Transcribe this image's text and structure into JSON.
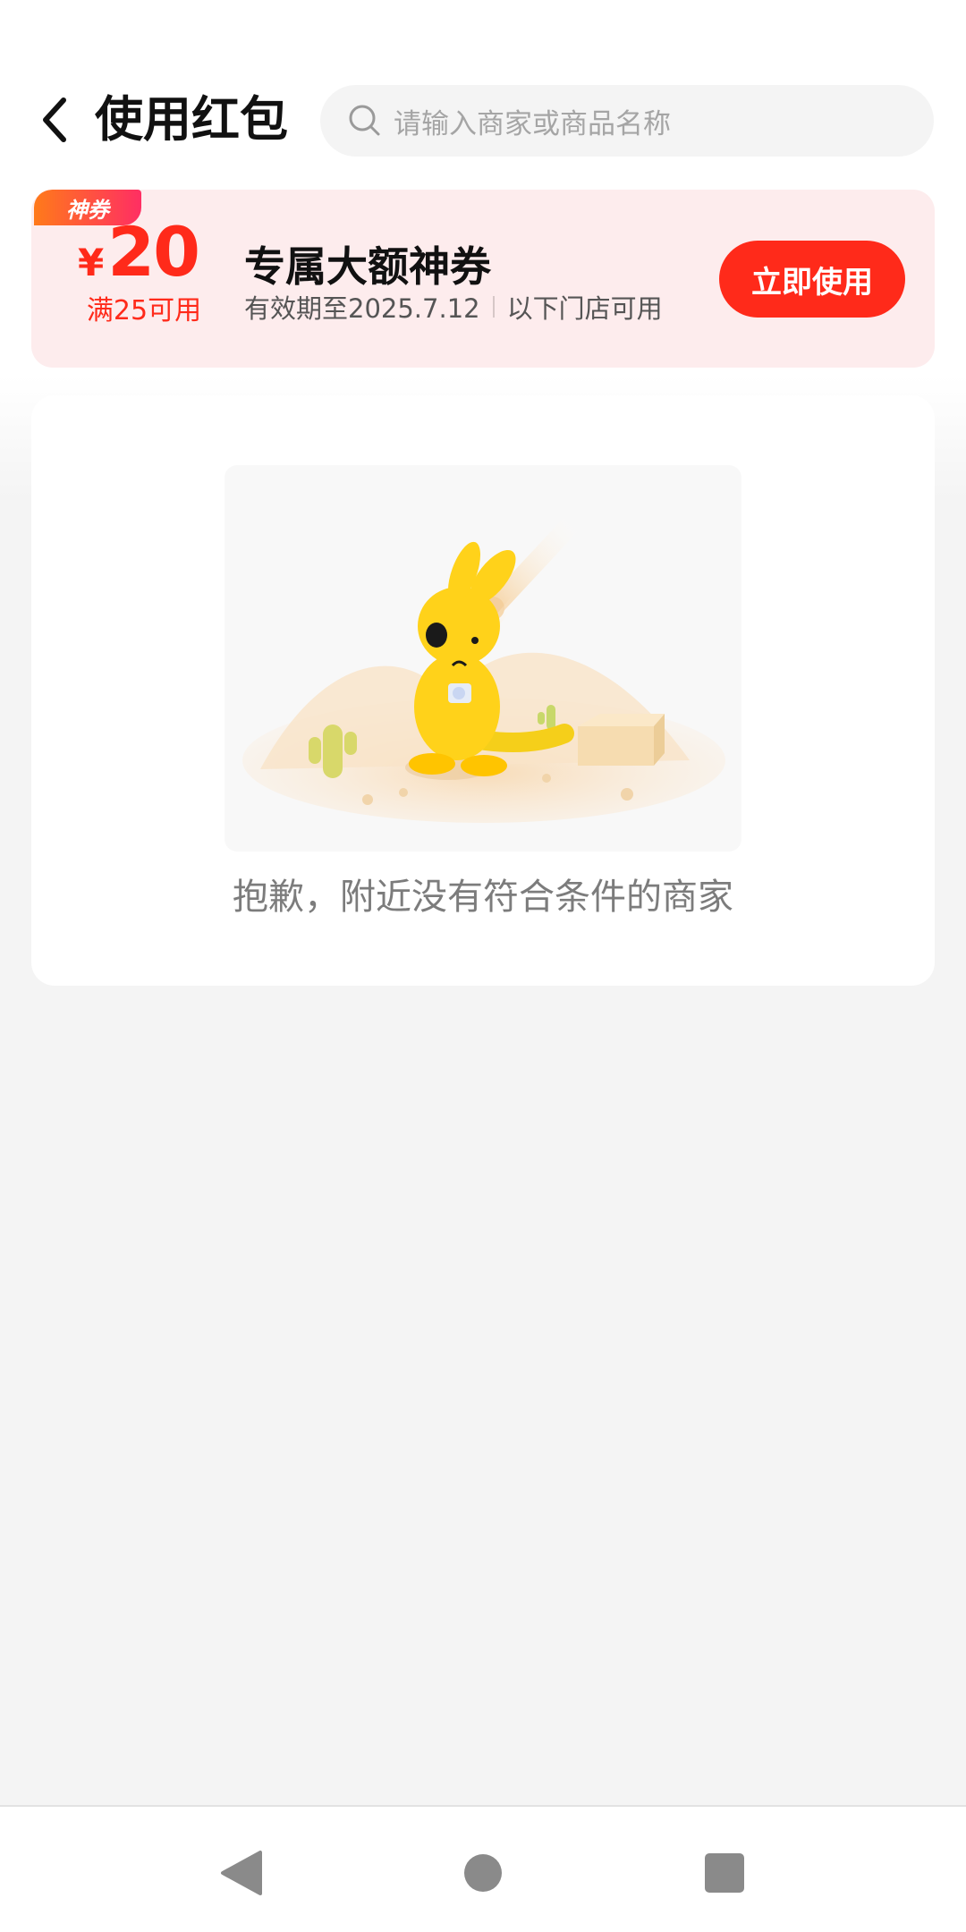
{
  "header": {
    "title": "使用红包",
    "search_placeholder": "请输入商家或商品名称"
  },
  "coupon": {
    "tag": "神券",
    "currency": "¥",
    "amount": "20",
    "threshold": "满25可用",
    "title": "专属大额神券",
    "validity": "有效期至2025.7.12",
    "scope": "以下门店可用",
    "button_label": "立即使用",
    "accent_color": "#ff2a1a",
    "background_color": "#fdeced"
  },
  "empty_state": {
    "message": "抱歉，附近没有符合条件的商家",
    "illustration": "sad-yellow-kangaroo-desert"
  },
  "nav_bar": {
    "icons": [
      "back-triangle-icon",
      "home-circle-icon",
      "recents-square-icon"
    ]
  }
}
